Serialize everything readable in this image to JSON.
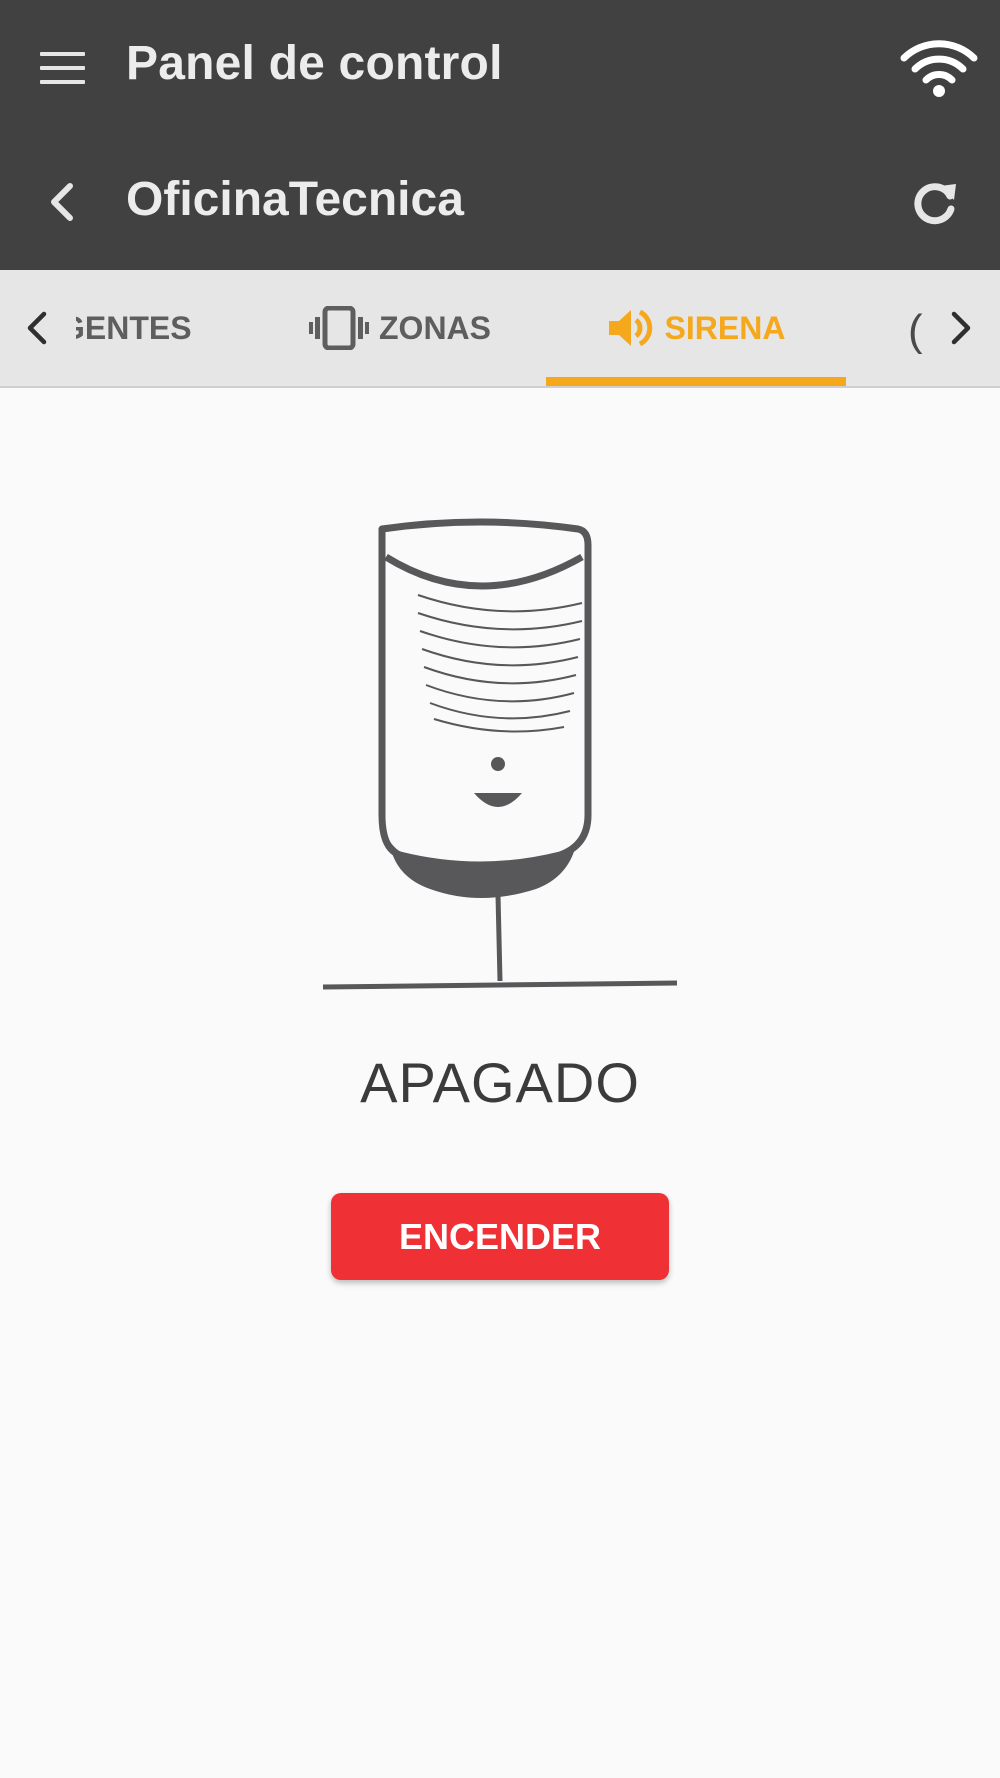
{
  "header": {
    "title": "Panel de control",
    "subtitle": "OficinaTecnica",
    "menu_icon": "hamburger-menu-icon",
    "status_icon": "wifi-icon",
    "back_icon": "chevron-left-icon",
    "refresh_icon": "refresh-icon"
  },
  "tabs": {
    "items": [
      {
        "label": "AGENTES",
        "visible_label": "GENTES",
        "icon": ""
      },
      {
        "label": "ZONAS",
        "icon": "vibration-icon"
      },
      {
        "label": "SIRENA",
        "icon": "speaker-icon",
        "active": true
      }
    ],
    "partial_next": "(",
    "active_color": "#f5a81c"
  },
  "siren": {
    "status": "APAGADO",
    "action_label": "ENCENDER",
    "action_color": "#ef3035"
  },
  "colors": {
    "toolbar": "#414142",
    "tabbar": "#e6e6e6",
    "background": "#fafafa"
  }
}
